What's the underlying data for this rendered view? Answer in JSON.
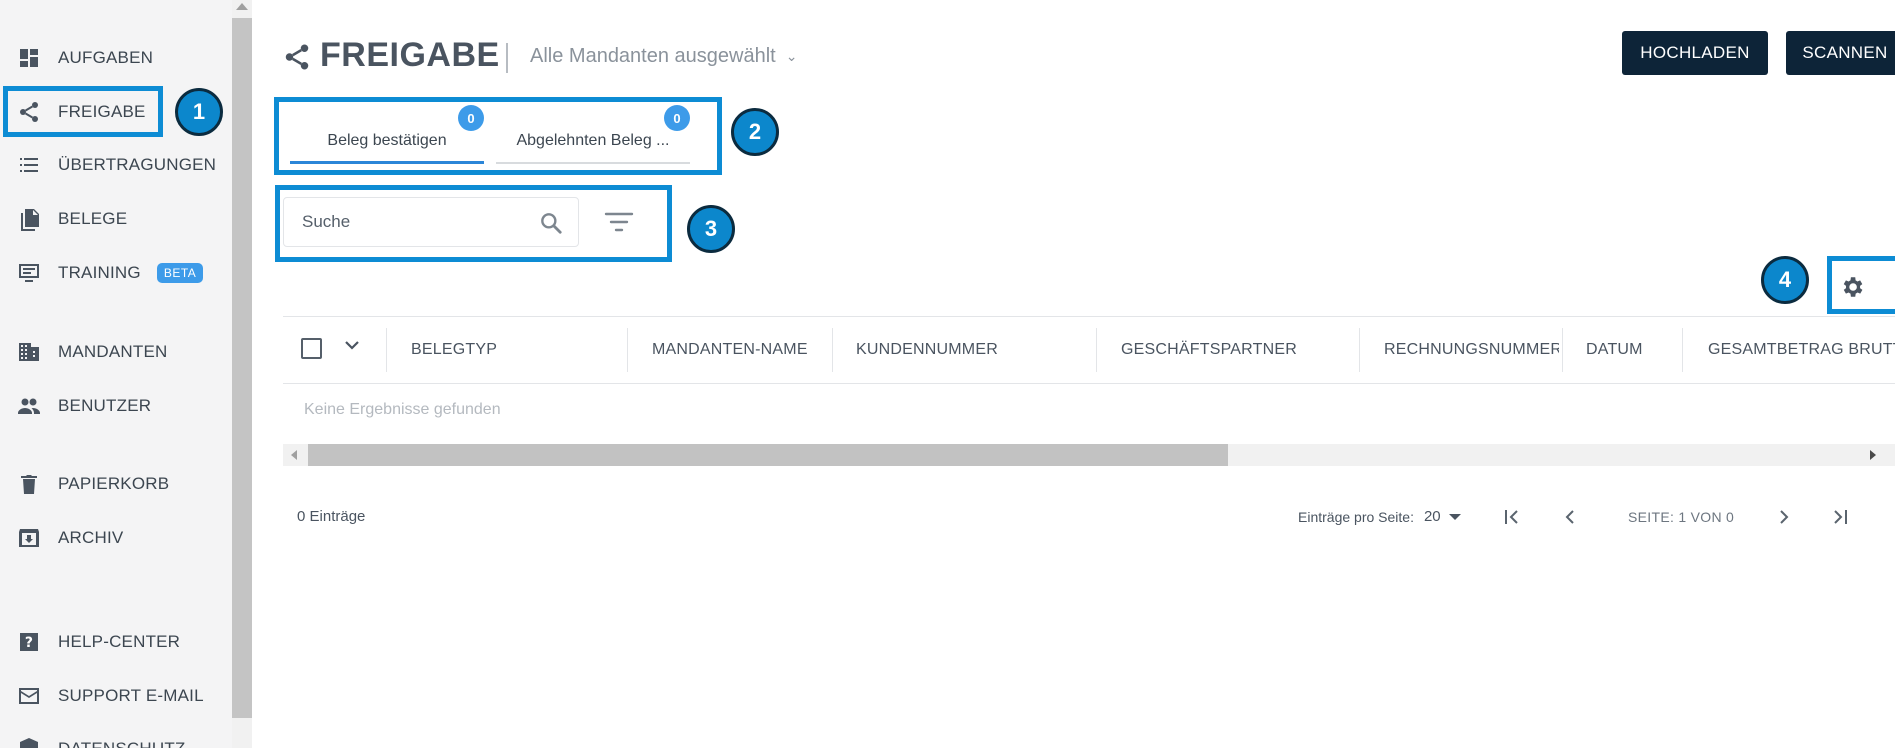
{
  "sidebar": {
    "items": [
      {
        "label": "AUFGABEN",
        "icon": "dashboard-icon"
      },
      {
        "label": "FREIGABE",
        "icon": "share-icon"
      },
      {
        "label": "ÜBERTRAGUNGEN",
        "icon": "list-icon"
      },
      {
        "label": "BELEGE",
        "icon": "documents-icon"
      },
      {
        "label": "TRAINING",
        "icon": "training-icon",
        "badge": "BETA"
      },
      {
        "label": "MANDANTEN",
        "icon": "building-icon"
      },
      {
        "label": "BENUTZER",
        "icon": "users-icon"
      },
      {
        "label": "PAPIERKORB",
        "icon": "trash-icon"
      },
      {
        "label": "ARCHIV",
        "icon": "archive-icon"
      },
      {
        "label": "HELP-CENTER",
        "icon": "help-icon"
      },
      {
        "label": "SUPPORT E-MAIL",
        "icon": "mail-icon"
      },
      {
        "label": "DATENSCHUTZ",
        "icon": "shield-icon"
      }
    ]
  },
  "header": {
    "title": "FREIGABE",
    "client_select": "Alle Mandanten ausgewählt",
    "upload_label": "HOCHLADEN",
    "scan_label": "SCANNEN"
  },
  "tabs": [
    {
      "label": "Beleg bestätigen",
      "count": "0",
      "active": true
    },
    {
      "label": "Abgelehnten Beleg ...",
      "count": "0",
      "active": false
    }
  ],
  "search": {
    "placeholder": "Suche"
  },
  "table": {
    "columns": [
      "BELEGTYP",
      "MANDANTEN-NAME",
      "KUNDENNUMMER",
      "GESCHÄFTSPARTNER",
      "RECHNUNGSNUMMER",
      "DATUM",
      "GESAMTBETRAG BRUTTO"
    ],
    "empty_text": "Keine Ergebnisse gefunden"
  },
  "footer": {
    "count": "0 Einträge",
    "per_page_label": "Einträge pro Seite:",
    "per_page_value": "20",
    "page_info": "SEITE: 1 VON 0"
  },
  "annotations": [
    "1",
    "2",
    "3",
    "4"
  ],
  "colors": {
    "highlight": "#0d8cd4",
    "badge": "#0c87cc",
    "button": "#0d2438",
    "accent": "#3d9be9"
  }
}
